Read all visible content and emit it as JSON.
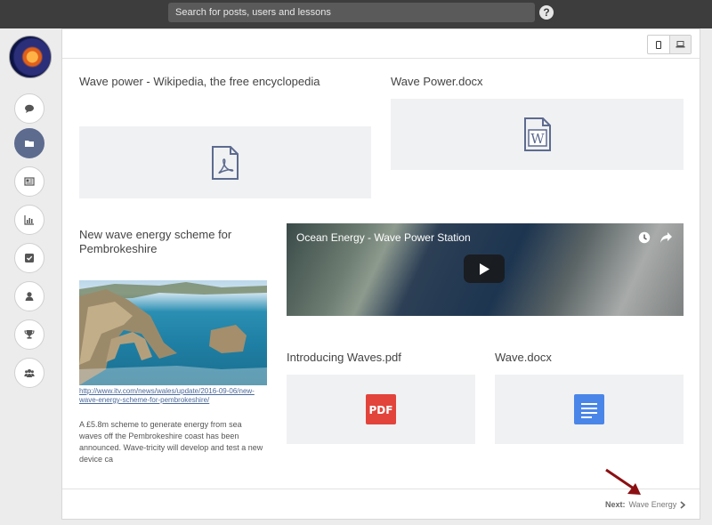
{
  "topbar": {
    "search_placeholder": "Search for posts, users and lessons",
    "help_label": "?"
  },
  "sidebar": {
    "items": [
      {
        "name": "chat-icon",
        "active": false
      },
      {
        "name": "folder-icon",
        "active": true
      },
      {
        "name": "newspaper-icon",
        "active": false
      },
      {
        "name": "bar-chart-icon",
        "active": false
      },
      {
        "name": "checkbox-icon",
        "active": false
      },
      {
        "name": "user-icon",
        "active": false
      },
      {
        "name": "trophy-icon",
        "active": false
      },
      {
        "name": "group-icon",
        "active": false
      }
    ]
  },
  "cards": {
    "wiki_title": "Wave power - Wikipedia, the free encyclopedia",
    "docx_title": "Wave Power.docx",
    "news_title": "New wave energy scheme for Pembrokeshire",
    "news_link": "http://www.itv.com/news/wales/update/2016-09-06/new-wave-energy-scheme-for-pembrokeshire/",
    "news_desc": "A £5.8m scheme to generate energy from sea waves off the Pembrokeshire coast has been announced. Wave-tricity will develop and test a new device ca",
    "video_title": "Ocean Energy - Wave Power Station",
    "pdf_title": "Introducing Waves.pdf",
    "gdoc_title": "Wave.docx",
    "pdf_badge": "PDF",
    "word_badge": "W"
  },
  "footer": {
    "next_label": "Next:",
    "next_target": "Wave Energy"
  },
  "colors": {
    "active_nav": "#5d6b8f",
    "pdf_red": "#e2443b",
    "gdoc_blue": "#4a86e8",
    "arrow": "#8b0f12"
  }
}
